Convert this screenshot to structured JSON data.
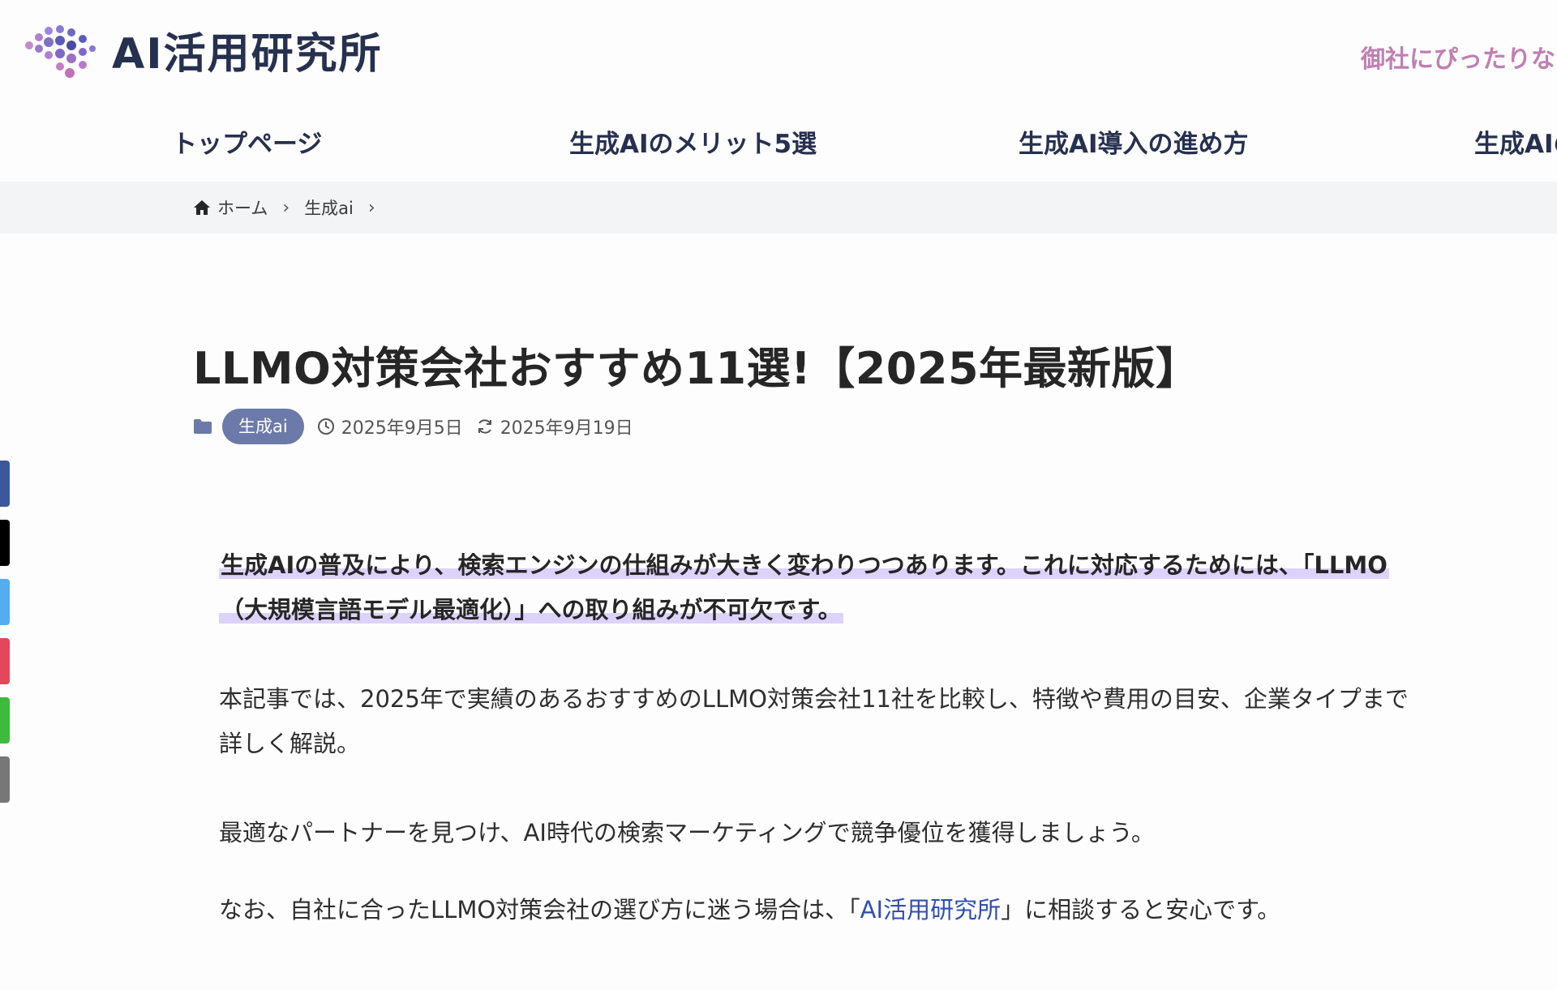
{
  "header": {
    "logo_text": "AI活用研究所",
    "cta_text": "御社にぴったりな"
  },
  "nav": {
    "items": [
      {
        "label": "トップページ"
      },
      {
        "label": "生成AIのメリット5選"
      },
      {
        "label": "生成AI導入の進め方"
      },
      {
        "label": "生成AIの"
      }
    ]
  },
  "breadcrumb": {
    "home": "ホーム",
    "category": "生成ai"
  },
  "post": {
    "title": "LLMO対策会社おすすめ11選!【2025年最新版】",
    "category": "生成ai",
    "published": "2025年9月5日",
    "updated": "2025年9月19日"
  },
  "body": {
    "lead_line1": "生成AIの普及により、検索エンジンの仕組みが大きく変わりつつあります。これに対応するためには、「LLMO",
    "lead_line2": "（大規模言語モデル最適化）」への取り組みが不可欠です。",
    "para1_line1": "本記事では、2025年で実績のあるおすすめのLLMO対策会社11社を比較し、特徴や費用の目安、企業タイプまで",
    "para1_line2": "詳しく解説。",
    "para2": "最適なパートナーを見つけ、AI時代の検索マーケティングで競争優位を獲得しましょう。",
    "para3_before": "なお、自社に合ったLLMO対策会社の選び方に迷う場合は、「",
    "para3_link": "AI活用研究所",
    "para3_after": "」に相談すると安心です。"
  },
  "share_rail": {
    "colors": [
      "#3b5998",
      "#000000",
      "#55acee",
      "#e2475b",
      "#3dbb3d",
      "#777777"
    ]
  },
  "theme": {
    "nav_text": "#26304f",
    "cta": "#c07fb2",
    "badge": "#6b7aa8",
    "highlight": "#ddd2fb",
    "link": "#2e4fb3"
  }
}
